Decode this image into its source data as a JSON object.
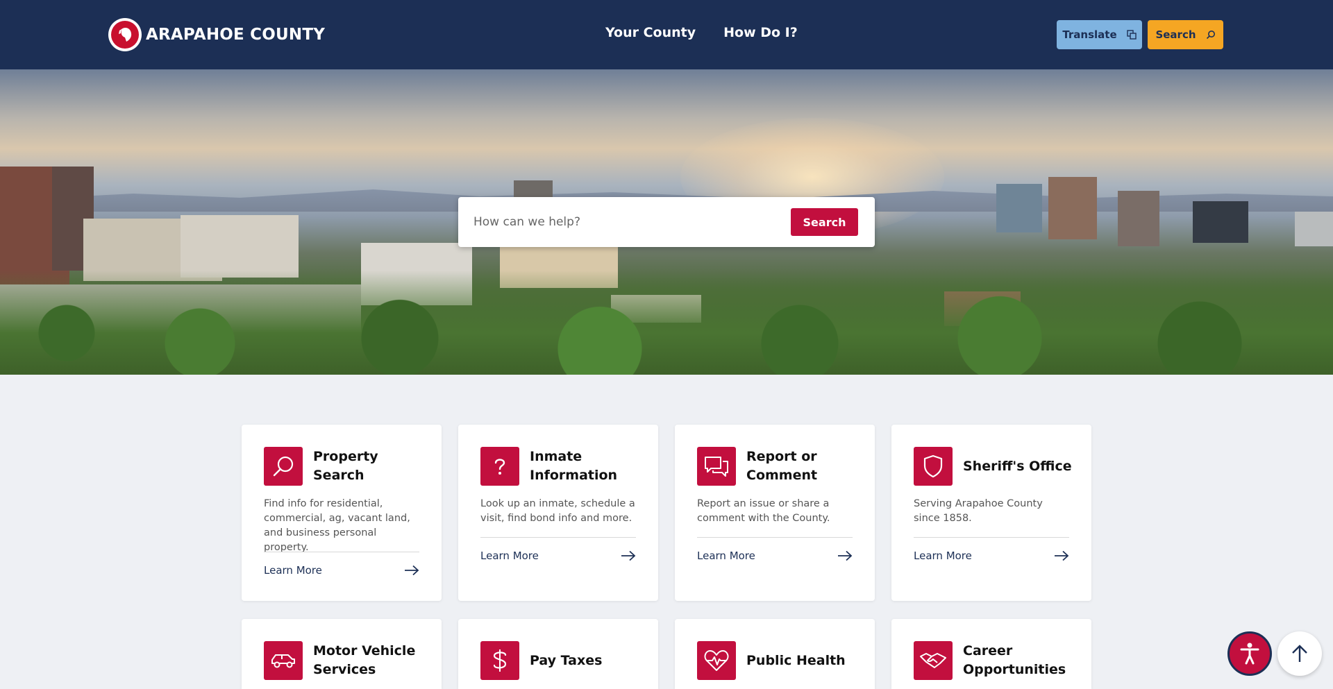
{
  "header": {
    "logo_text": "ARAPAHOE COUNTY",
    "nav": [
      "Your County",
      "How Do I?"
    ],
    "translate_label": "Translate",
    "search_label": "Search"
  },
  "hero": {
    "search_placeholder": "How can we help?",
    "search_button": "Search"
  },
  "cards": [
    {
      "title": "Property Search",
      "description": "Find info for residential, commercial, ag, vacant land, and business personal property.",
      "link": "Learn More",
      "icon": "magnifier-icon"
    },
    {
      "title": "Inmate Information",
      "description": "Look up an inmate, schedule a visit, find bond info and more.",
      "link": "Learn More",
      "icon": "question-icon"
    },
    {
      "title": "Report or Comment",
      "description": "Report an issue or share a comment with the County.",
      "link": "Learn More",
      "icon": "chat-bubbles-icon"
    },
    {
      "title": "Sheriff's Office",
      "description": "Serving Arapahoe County since 1858.",
      "link": "Learn More",
      "icon": "shield-icon"
    },
    {
      "title": "Motor Vehicle Services",
      "icon": "car-icon"
    },
    {
      "title": "Pay Taxes",
      "icon": "dollar-icon"
    },
    {
      "title": "Public Health",
      "icon": "heartbeat-icon"
    },
    {
      "title": "Career Opportunities",
      "icon": "handshake-icon"
    }
  ],
  "colors": {
    "header_bg": "#1c2f55",
    "accent_red": "#c20f3e",
    "translate_bg": "#7fb3e0",
    "search_bg": "#f5a623"
  }
}
